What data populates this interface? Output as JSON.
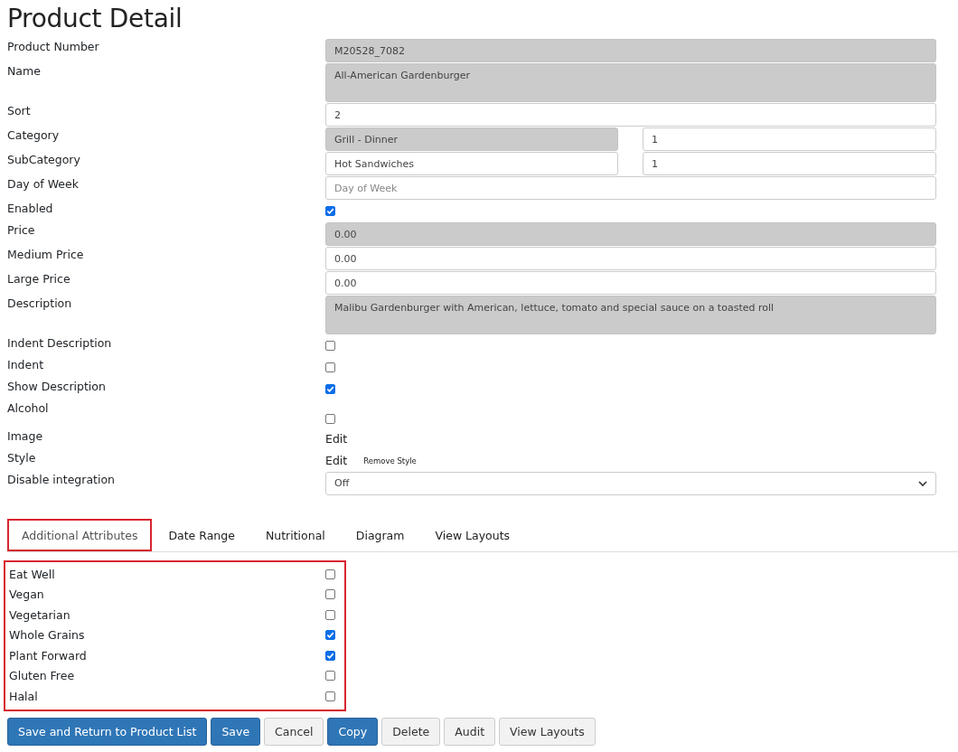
{
  "title": "Product Detail",
  "fields": [
    {
      "label": "Product Number",
      "kind": "input",
      "value": "M20528_7082",
      "disabled": true
    },
    {
      "label": "Name",
      "kind": "textarea",
      "value": "All-American Gardenburger",
      "disabled": true
    },
    {
      "label": "Sort",
      "kind": "input",
      "value": "2",
      "disabled": false
    },
    {
      "label": "Category",
      "kind": "pair",
      "value": "Grill - Dinner",
      "disabled": true,
      "second_value": "1"
    },
    {
      "label": "SubCategory",
      "kind": "pair",
      "value": "Hot Sandwiches",
      "disabled": false,
      "second_value": "1"
    },
    {
      "label": "Day of Week",
      "kind": "input",
      "placeholder": "Day of Week",
      "disabled": false
    },
    {
      "label": "Enabled",
      "kind": "checkbox",
      "checked": true
    },
    {
      "label": "Price",
      "kind": "input",
      "value": "0.00",
      "disabled": true
    },
    {
      "label": "Medium Price",
      "kind": "input",
      "value": "0.00",
      "disabled": false
    },
    {
      "label": "Large Price",
      "kind": "input",
      "value": "0.00",
      "disabled": false
    },
    {
      "label": "Description",
      "kind": "textarea",
      "value": "Malibu Gardenburger with American, lettuce, tomato and special sauce on a toasted roll",
      "disabled": true
    },
    {
      "label": "Indent Description",
      "kind": "checkbox",
      "checked": false
    },
    {
      "label": "Indent",
      "kind": "checkbox",
      "checked": false
    },
    {
      "label": "Show Description",
      "kind": "checkbox",
      "checked": true
    },
    {
      "label": "Alcohol",
      "kind": "checkbox",
      "checked": false
    },
    {
      "label": "Image",
      "kind": "links",
      "links": [
        "Edit"
      ]
    },
    {
      "label": "Style",
      "kind": "links",
      "links": [
        "Edit",
        "Remove Style"
      ]
    },
    {
      "label": "Disable integration",
      "kind": "select",
      "value": "Off"
    }
  ],
  "tabs": [
    {
      "label": "Additional Attributes",
      "selected": true
    },
    {
      "label": "Date Range",
      "selected": false
    },
    {
      "label": "Nutritional",
      "selected": false
    },
    {
      "label": "Diagram",
      "selected": false
    },
    {
      "label": "View Layouts",
      "selected": false
    }
  ],
  "attributes": [
    {
      "label": "Eat Well",
      "checked": false
    },
    {
      "label": "Vegan",
      "checked": false
    },
    {
      "label": "Vegetarian",
      "checked": false
    },
    {
      "label": "Whole Grains",
      "checked": true
    },
    {
      "label": "Plant Forward",
      "checked": true
    },
    {
      "label": "Gluten Free",
      "checked": false
    },
    {
      "label": "Halal",
      "checked": false
    }
  ],
  "buttons": [
    {
      "label": "Save and Return to Product List",
      "kind": "primary"
    },
    {
      "label": "Save",
      "kind": "primary"
    },
    {
      "label": "Cancel",
      "kind": "default"
    },
    {
      "label": "Copy",
      "kind": "primary"
    },
    {
      "label": "Delete",
      "kind": "default"
    },
    {
      "label": "Audit",
      "kind": "default"
    },
    {
      "label": "View Layouts",
      "kind": "default"
    }
  ]
}
